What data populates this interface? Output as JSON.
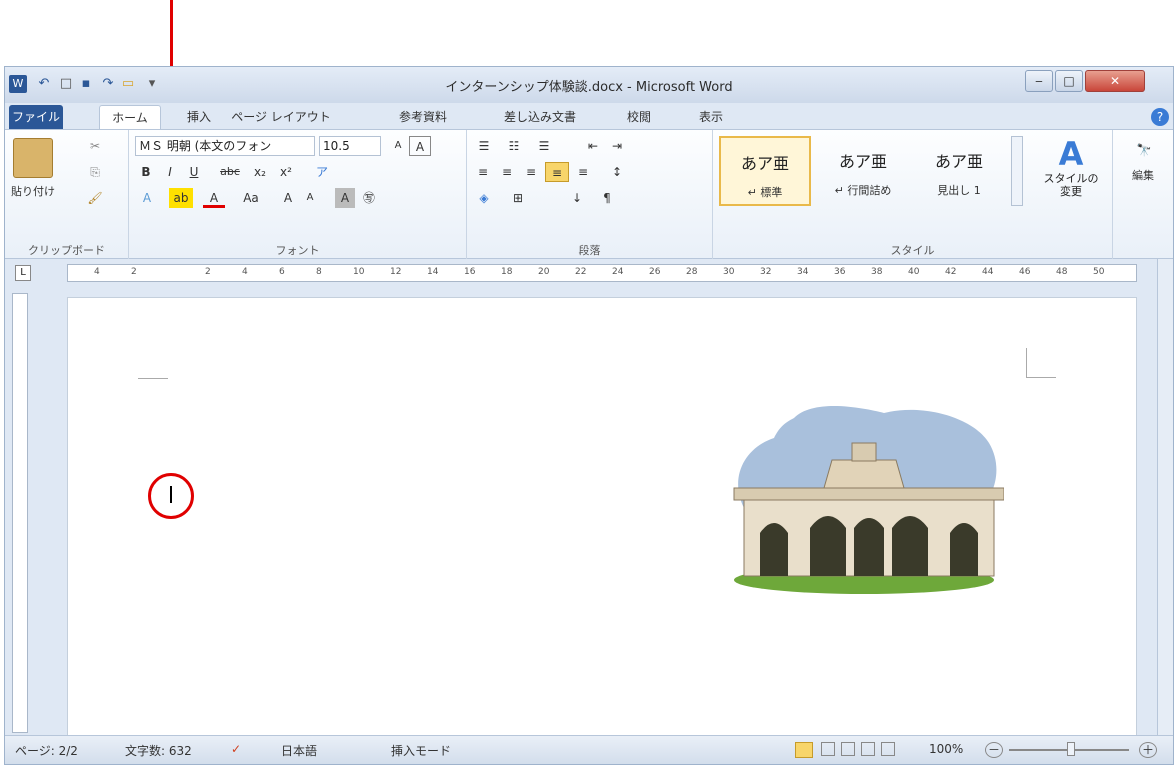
{
  "titlebar": {
    "title": "インターンシップ体験談.docx - Microsoft Word",
    "app_icon": "W",
    "qat_undo": "↶",
    "qat_new": "□",
    "qat_save": "▪",
    "qat_redo": "↷",
    "qat_open": "▭",
    "qat_custom": "▾",
    "minimize": "‒",
    "maximize": "□",
    "close": "✕"
  },
  "tabs": {
    "file": "ファイル",
    "home": "ホーム",
    "insert": "挿入",
    "page_layout": "ページ レイアウト",
    "references": "参考資料",
    "mailings": "差し込み文書",
    "review": "校閲",
    "view": "表示",
    "help": "?"
  },
  "clipboard": {
    "paste": "貼り付け",
    "group_label": "クリップボード",
    "cut": "✂",
    "copy": "⎘",
    "format_painter": "🖌"
  },
  "font": {
    "name": "ＭＳ 明朝 (本文のフォン",
    "size": "10.5",
    "group_label": "フォント",
    "bold": "B",
    "italic": "I",
    "underline": "U",
    "strike": "abc",
    "subscript": "x₂",
    "superscript": "x²",
    "grow": "A",
    "shrink": "A",
    "case": "Aa",
    "highlight": "ab",
    "color": "A",
    "clear": "A",
    "boxed": "A",
    "enclosed": "㊢",
    "phonetic": "ア"
  },
  "paragraph": {
    "group_label": "段落",
    "bullets": "☰",
    "numbering": "☷",
    "multilevel": "☰",
    "decrease_indent": "⇤",
    "increase_indent": "⇥",
    "align_left": "≡",
    "center": "≡",
    "align_right": "≡",
    "justify": "≡",
    "distributed": "≡",
    "line_spacing": "↕",
    "shading": "◈",
    "borders": "⊞",
    "sort": "↓",
    "show_marks": "¶"
  },
  "styles": {
    "group_label": "スタイル",
    "items": [
      {
        "sample": "あア亜",
        "name": "↵ 標準"
      },
      {
        "sample": "あア亜",
        "name": "↵ 行間詰め"
      },
      {
        "sample": "あア亜",
        "name": "見出し 1"
      }
    ],
    "change": "スタイルの\n変更"
  },
  "edit": {
    "label": "編集",
    "icon": "🔭"
  },
  "ruler_ticks": [
    "4",
    "2",
    "",
    "2",
    "4",
    "6",
    "8",
    "10",
    "12",
    "14",
    "16",
    "18",
    "20",
    "22",
    "24",
    "26",
    "28",
    "30",
    "32",
    "34",
    "36",
    "38",
    "40",
    "42",
    "44",
    "46",
    "48",
    "50"
  ],
  "status": {
    "page": "ページ: 2/2",
    "words": "文字数: 632",
    "language": "日本語",
    "mode": "挿入モード",
    "zoom": "100%",
    "zoom_out": "－",
    "zoom_in": "＋"
  }
}
